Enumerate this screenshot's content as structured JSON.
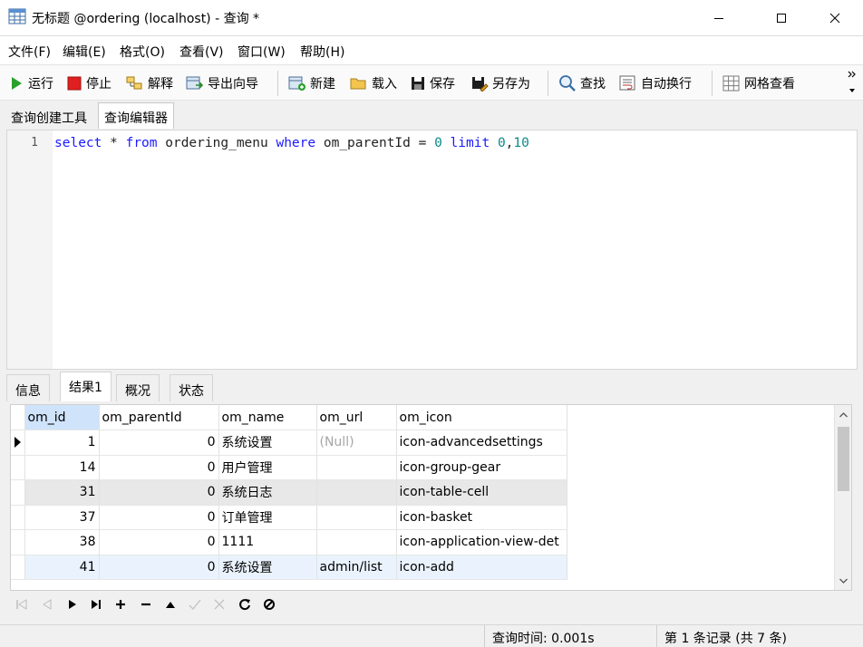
{
  "window": {
    "title": "无标题 @ordering (localhost) - 查询 *",
    "app_icon": "grid-table-icon",
    "controls": [
      "minimize-icon",
      "maximize-icon",
      "close-icon"
    ]
  },
  "menu": [
    "文件(F)",
    "编辑(E)",
    "格式(O)",
    "查看(V)",
    "窗口(W)",
    "帮助(H)"
  ],
  "toolbar": {
    "run": "运行",
    "stop": "停止",
    "explain": "解释",
    "export_wizard": "导出向导",
    "new": "新建",
    "load": "载入",
    "save": "保存",
    "save_as": "另存为",
    "find": "查找",
    "word_wrap": "自动换行",
    "grid_view": "网格查看"
  },
  "query_tabs": [
    "查询创建工具",
    "查询编辑器"
  ],
  "editor": {
    "line_number": "1",
    "tokens": [
      "select",
      " * ",
      "from",
      " ordering_menu ",
      "where",
      " om_parentId = ",
      "0",
      " ",
      "limit",
      " ",
      "0",
      ",",
      "10"
    ]
  },
  "result_tabs": [
    "信息",
    "结果1",
    "概况",
    "状态"
  ],
  "grid": {
    "columns": [
      "om_id",
      "om_parentId",
      "om_name",
      "om_url",
      "om_icon"
    ],
    "rows": [
      [
        "1",
        "0",
        "系统设置",
        "(Null)",
        "icon-advancedsettings"
      ],
      [
        "14",
        "0",
        "用户管理",
        "",
        "icon-group-gear"
      ],
      [
        "31",
        "0",
        "系统日志",
        "",
        "icon-table-cell"
      ],
      [
        "37",
        "0",
        "订单管理",
        "",
        "icon-basket"
      ],
      [
        "38",
        "0",
        "1111",
        "",
        "icon-application-view-det"
      ],
      [
        "41",
        "0",
        "系统设置",
        "admin/list",
        "icon-add"
      ]
    ]
  },
  "status": {
    "query_time": "查询时间: 0.001s",
    "record": "第 1 条记录 (共 7 条)"
  },
  "colors": {
    "keyword": "#1a1aff",
    "number": "#0a8a8a",
    "header_selected": "#cfe3fb",
    "run_green": "#2aa12a",
    "stop_red": "#e02020"
  }
}
